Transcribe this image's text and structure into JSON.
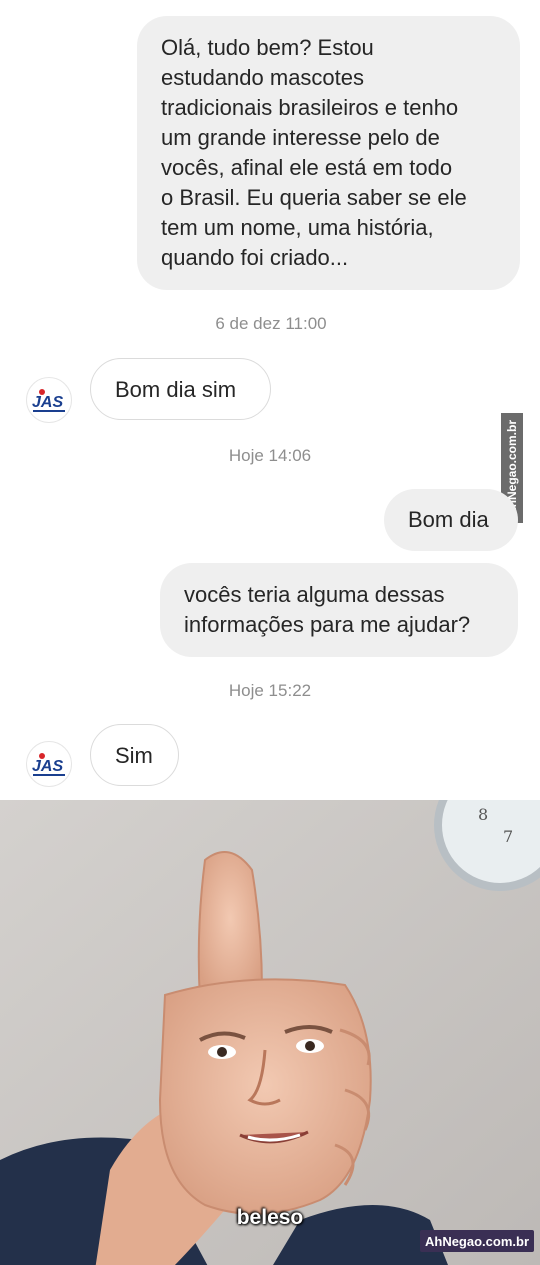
{
  "messages": [
    {
      "side": "outgoing",
      "text": "Olá, tudo bem? Estou\nestudando mascotes\ntradicionais brasileiros e tenho\num grande interesse pelo de\nvocês, afinal ele está em todo\no Brasil. Eu queria saber se ele\ntem um nome, uma história,\nquando foi criado..."
    },
    {
      "side": "incoming",
      "text": "Bom dia sim"
    },
    {
      "side": "outgoing",
      "text": "Bom dia"
    },
    {
      "side": "outgoing",
      "text": "vocês teria alguma dessas\ninformações para me ajudar?"
    },
    {
      "side": "incoming",
      "text": "Sim"
    }
  ],
  "timestamps": [
    "6 de dez 11:00",
    "Hoje 14:06",
    "Hoje 15:22"
  ],
  "avatar_logo": "JAS",
  "watermark_side": "AhNegao.com.br",
  "meme_caption": "beleso",
  "watermark_corner": "AhNegao.com.br",
  "colors": {
    "outgoing_bubble": "#efefef",
    "incoming_bubble": "#ffffff",
    "timestamp": "#8e8e8e",
    "logo_blue": "#1a3f8f",
    "logo_red": "#d8262a"
  }
}
